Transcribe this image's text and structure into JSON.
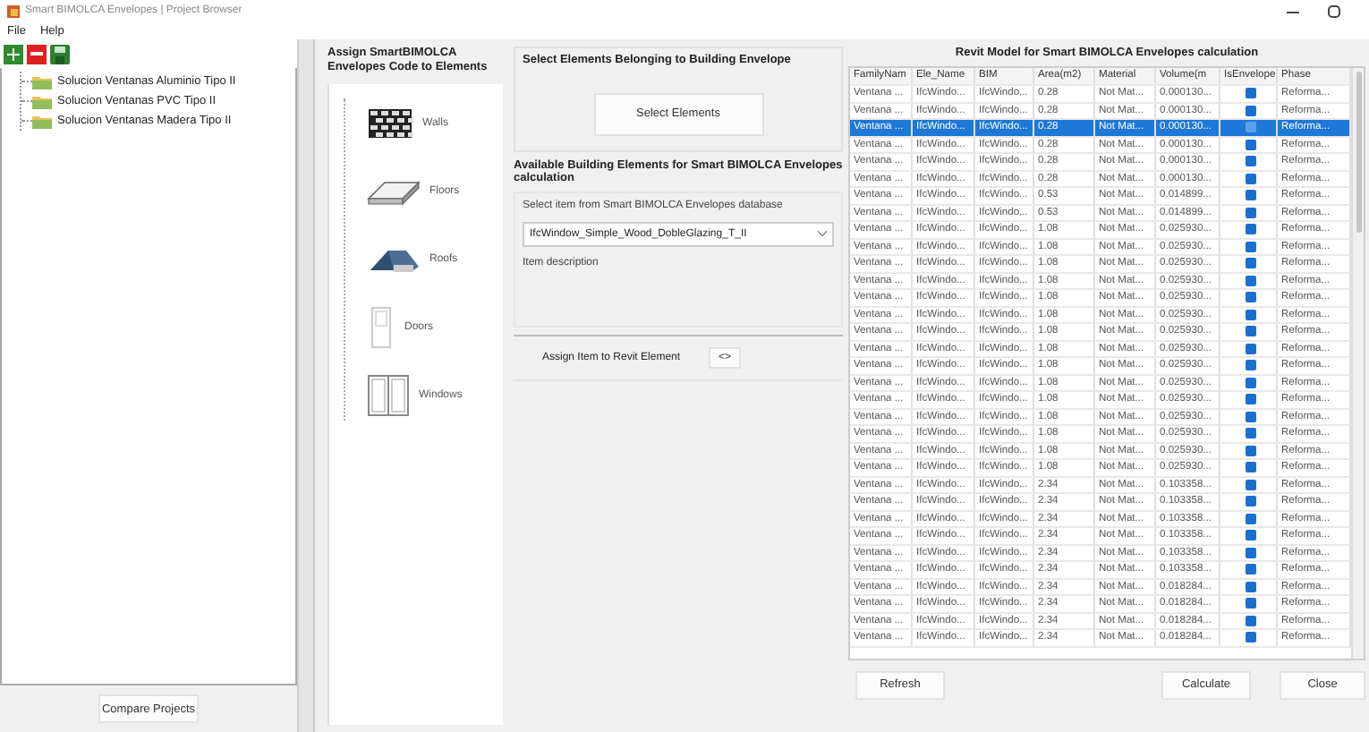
{
  "window": {
    "title": "Smart BIMOLCA Envelopes | Project Browser"
  },
  "menu": [
    "File",
    "Help"
  ],
  "projects": {
    "items": [
      {
        "label": "Solucion Ventanas Aluminio Tipo II"
      },
      {
        "label": "Solucion Ventanas PVC Tipo II"
      },
      {
        "label": "Solucion Ventanas Madera Tipo II"
      }
    ],
    "compare_button": "Compare Projects"
  },
  "assign_panel": {
    "heading": "Assign SmartBIMOLCA Envelopes Code to Elements",
    "categories": [
      {
        "kind": "walls",
        "label": "Walls"
      },
      {
        "kind": "floors",
        "label": "Floors"
      },
      {
        "kind": "roofs",
        "label": "Roofs"
      },
      {
        "kind": "doors",
        "label": "Doors"
      },
      {
        "kind": "windows",
        "label": "Windows"
      }
    ]
  },
  "select_group": {
    "heading": "Select Elements Belonging to Building Envelope",
    "button": "Select Elements"
  },
  "available": {
    "heading": "Available Building Elements for Smart BIMOLCA Envelopes calculation",
    "hint": "Select item from Smart BIMOLCA Envelopes database",
    "dropdown_value": "IfcWindow_Simple_Wood_DobleGlazing_T_II",
    "description": "Item description",
    "assign_label": "Assign Item to Revit Element",
    "assign_button": "<>"
  },
  "table": {
    "title": "Revit Model for Smart BIMOLCA Envelopes calculation",
    "columns": [
      "FamilyNam",
      "Ele_Name",
      "BIM",
      "Area(m2)",
      "Material",
      "Volume(m",
      "IsEnvelope",
      "Phase"
    ],
    "rows": [
      {
        "family": "Ventana ...",
        "ele_name": "IfcWindo...",
        "bim": "IfcWindo...",
        "area": "0.28",
        "material": "Not Mat...",
        "volume": "0.000130...",
        "is_envelope": true,
        "phase": "Reforma...",
        "selected": false
      },
      {
        "family": "Ventana ...",
        "ele_name": "IfcWindo...",
        "bim": "IfcWindo...",
        "area": "0.28",
        "material": "Not Mat...",
        "volume": "0.000130...",
        "is_envelope": true,
        "phase": "Reforma...",
        "selected": false
      },
      {
        "family": "Ventana ...",
        "ele_name": "IfcWindo...",
        "bim": "IfcWindo...",
        "area": "0.28",
        "material": "Not Mat...",
        "volume": "0.000130...",
        "is_envelope": true,
        "phase": "Reforma...",
        "selected": true
      },
      {
        "family": "Ventana ...",
        "ele_name": "IfcWindo...",
        "bim": "IfcWindo...",
        "area": "0.28",
        "material": "Not Mat...",
        "volume": "0.000130...",
        "is_envelope": true,
        "phase": "Reforma...",
        "selected": false
      },
      {
        "family": "Ventana ...",
        "ele_name": "IfcWindo...",
        "bim": "IfcWindo...",
        "area": "0.28",
        "material": "Not Mat...",
        "volume": "0.000130...",
        "is_envelope": true,
        "phase": "Reforma...",
        "selected": false
      },
      {
        "family": "Ventana ...",
        "ele_name": "IfcWindo...",
        "bim": "IfcWindo...",
        "area": "0.28",
        "material": "Not Mat...",
        "volume": "0.000130...",
        "is_envelope": true,
        "phase": "Reforma...",
        "selected": false
      },
      {
        "family": "Ventana ...",
        "ele_name": "IfcWindo...",
        "bim": "IfcWindo...",
        "area": "0.53",
        "material": "Not Mat...",
        "volume": "0.014899...",
        "is_envelope": true,
        "phase": "Reforma...",
        "selected": false
      },
      {
        "family": "Ventana ...",
        "ele_name": "IfcWindo...",
        "bim": "IfcWindo...",
        "area": "0.53",
        "material": "Not Mat...",
        "volume": "0.014899...",
        "is_envelope": true,
        "phase": "Reforma...",
        "selected": false
      },
      {
        "family": "Ventana ...",
        "ele_name": "IfcWindo...",
        "bim": "IfcWindo...",
        "area": "1.08",
        "material": "Not Mat...",
        "volume": "0.025930...",
        "is_envelope": true,
        "phase": "Reforma...",
        "selected": false
      },
      {
        "family": "Ventana ...",
        "ele_name": "IfcWindo...",
        "bim": "IfcWindo...",
        "area": "1.08",
        "material": "Not Mat...",
        "volume": "0.025930...",
        "is_envelope": true,
        "phase": "Reforma...",
        "selected": false
      },
      {
        "family": "Ventana ...",
        "ele_name": "IfcWindo...",
        "bim": "IfcWindo...",
        "area": "1.08",
        "material": "Not Mat...",
        "volume": "0.025930...",
        "is_envelope": true,
        "phase": "Reforma...",
        "selected": false
      },
      {
        "family": "Ventana ...",
        "ele_name": "IfcWindo...",
        "bim": "IfcWindo...",
        "area": "1.08",
        "material": "Not Mat...",
        "volume": "0.025930...",
        "is_envelope": true,
        "phase": "Reforma...",
        "selected": false
      },
      {
        "family": "Ventana ...",
        "ele_name": "IfcWindo...",
        "bim": "IfcWindo...",
        "area": "1.08",
        "material": "Not Mat...",
        "volume": "0.025930...",
        "is_envelope": true,
        "phase": "Reforma...",
        "selected": false
      },
      {
        "family": "Ventana ...",
        "ele_name": "IfcWindo...",
        "bim": "IfcWindo...",
        "area": "1.08",
        "material": "Not Mat...",
        "volume": "0.025930...",
        "is_envelope": true,
        "phase": "Reforma...",
        "selected": false
      },
      {
        "family": "Ventana ...",
        "ele_name": "IfcWindo...",
        "bim": "IfcWindo...",
        "area": "1.08",
        "material": "Not Mat...",
        "volume": "0.025930...",
        "is_envelope": true,
        "phase": "Reforma...",
        "selected": false
      },
      {
        "family": "Ventana ...",
        "ele_name": "IfcWindo...",
        "bim": "IfcWindo...",
        "area": "1.08",
        "material": "Not Mat...",
        "volume": "0.025930...",
        "is_envelope": true,
        "phase": "Reforma...",
        "selected": false
      },
      {
        "family": "Ventana ...",
        "ele_name": "IfcWindo...",
        "bim": "IfcWindo...",
        "area": "1.08",
        "material": "Not Mat...",
        "volume": "0.025930...",
        "is_envelope": true,
        "phase": "Reforma...",
        "selected": false
      },
      {
        "family": "Ventana ...",
        "ele_name": "IfcWindo...",
        "bim": "IfcWindo...",
        "area": "1.08",
        "material": "Not Mat...",
        "volume": "0.025930...",
        "is_envelope": true,
        "phase": "Reforma...",
        "selected": false
      },
      {
        "family": "Ventana ...",
        "ele_name": "IfcWindo...",
        "bim": "IfcWindo...",
        "area": "1.08",
        "material": "Not Mat...",
        "volume": "0.025930...",
        "is_envelope": true,
        "phase": "Reforma...",
        "selected": false
      },
      {
        "family": "Ventana ...",
        "ele_name": "IfcWindo...",
        "bim": "IfcWindo...",
        "area": "1.08",
        "material": "Not Mat...",
        "volume": "0.025930...",
        "is_envelope": true,
        "phase": "Reforma...",
        "selected": false
      },
      {
        "family": "Ventana ...",
        "ele_name": "IfcWindo...",
        "bim": "IfcWindo...",
        "area": "1.08",
        "material": "Not Mat...",
        "volume": "0.025930...",
        "is_envelope": true,
        "phase": "Reforma...",
        "selected": false
      },
      {
        "family": "Ventana ...",
        "ele_name": "IfcWindo...",
        "bim": "IfcWindo...",
        "area": "1.08",
        "material": "Not Mat...",
        "volume": "0.025930...",
        "is_envelope": true,
        "phase": "Reforma...",
        "selected": false
      },
      {
        "family": "Ventana ...",
        "ele_name": "IfcWindo...",
        "bim": "IfcWindo...",
        "area": "1.08",
        "material": "Not Mat...",
        "volume": "0.025930...",
        "is_envelope": true,
        "phase": "Reforma...",
        "selected": false
      },
      {
        "family": "Ventana ...",
        "ele_name": "IfcWindo...",
        "bim": "IfcWindo...",
        "area": "2.34",
        "material": "Not Mat...",
        "volume": "0.103358...",
        "is_envelope": true,
        "phase": "Reforma...",
        "selected": false
      },
      {
        "family": "Ventana ...",
        "ele_name": "IfcWindo...",
        "bim": "IfcWindo...",
        "area": "2.34",
        "material": "Not Mat...",
        "volume": "0.103358...",
        "is_envelope": true,
        "phase": "Reforma...",
        "selected": false
      },
      {
        "family": "Ventana ...",
        "ele_name": "IfcWindo...",
        "bim": "IfcWindo...",
        "area": "2.34",
        "material": "Not Mat...",
        "volume": "0.103358...",
        "is_envelope": true,
        "phase": "Reforma...",
        "selected": false
      },
      {
        "family": "Ventana ...",
        "ele_name": "IfcWindo...",
        "bim": "IfcWindo...",
        "area": "2.34",
        "material": "Not Mat...",
        "volume": "0.103358...",
        "is_envelope": true,
        "phase": "Reforma...",
        "selected": false
      },
      {
        "family": "Ventana ...",
        "ele_name": "IfcWindo...",
        "bim": "IfcWindo...",
        "area": "2.34",
        "material": "Not Mat...",
        "volume": "0.103358...",
        "is_envelope": true,
        "phase": "Reforma...",
        "selected": false
      },
      {
        "family": "Ventana ...",
        "ele_name": "IfcWindo...",
        "bim": "IfcWindo...",
        "area": "2.34",
        "material": "Not Mat...",
        "volume": "0.103358...",
        "is_envelope": true,
        "phase": "Reforma...",
        "selected": false
      },
      {
        "family": "Ventana ...",
        "ele_name": "IfcWindo...",
        "bim": "IfcWindo...",
        "area": "2.34",
        "material": "Not Mat...",
        "volume": "0.018284...",
        "is_envelope": true,
        "phase": "Reforma...",
        "selected": false
      },
      {
        "family": "Ventana ...",
        "ele_name": "IfcWindo...",
        "bim": "IfcWindo...",
        "area": "2.34",
        "material": "Not Mat...",
        "volume": "0.018284...",
        "is_envelope": true,
        "phase": "Reforma...",
        "selected": false
      },
      {
        "family": "Ventana ...",
        "ele_name": "IfcWindo...",
        "bim": "IfcWindo...",
        "area": "2.34",
        "material": "Not Mat...",
        "volume": "0.018284...",
        "is_envelope": true,
        "phase": "Reforma...",
        "selected": false
      },
      {
        "family": "Ventana ...",
        "ele_name": "IfcWindo...",
        "bim": "IfcWindo...",
        "area": "2.34",
        "material": "Not Mat...",
        "volume": "0.018284...",
        "is_envelope": true,
        "phase": "Reforma...",
        "selected": false
      }
    ]
  },
  "buttons": {
    "refresh": "Refresh",
    "calculate": "Calculate",
    "close": "Close"
  }
}
